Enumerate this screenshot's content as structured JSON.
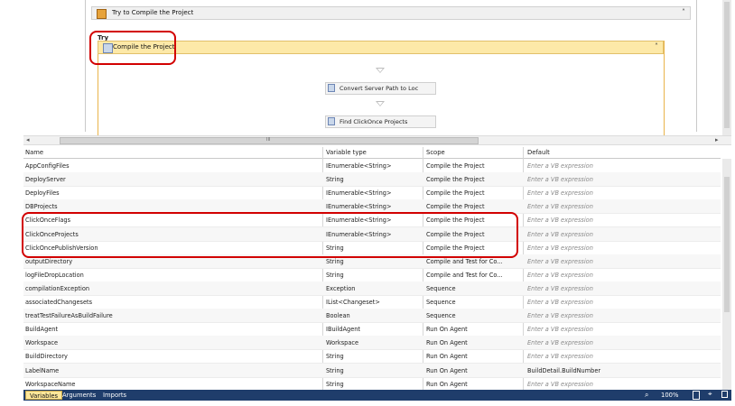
{
  "designer": {
    "outer_sequence": "Try to Compile the Project",
    "try_label": "Try",
    "inner_sequence": "Compile the Project",
    "activities": [
      "Convert Server Path to Loc",
      "Find ClickOnce Projects"
    ]
  },
  "hscroll_grip": "III",
  "grid": {
    "columns": [
      "Name",
      "Variable type",
      "Scope",
      "Default"
    ],
    "rows": [
      {
        "name": "AppConfigFiles",
        "type": "IEnumerable<String>",
        "scope": "Compile the Project",
        "default": "Enter a VB expression"
      },
      {
        "name": "DeployServer",
        "type": "String",
        "scope": "Compile the Project",
        "default": "Enter a VB expression"
      },
      {
        "name": "DeployFiles",
        "type": "IEnumerable<String>",
        "scope": "Compile the Project",
        "default": "Enter a VB expression"
      },
      {
        "name": "DBProjects",
        "type": "IEnumerable<String>",
        "scope": "Compile the Project",
        "default": "Enter a VB expression"
      },
      {
        "name": "ClickOnceFlags",
        "type": "IEnumerable<String>",
        "scope": "Compile the Project",
        "default": "Enter a VB expression"
      },
      {
        "name": "ClickOnceProjects",
        "type": "IEnumerable<String>",
        "scope": "Compile the Project",
        "default": "Enter a VB expression"
      },
      {
        "name": "ClickOncePublishVersion",
        "type": "String",
        "scope": "Compile the Project",
        "default": "Enter a VB expression"
      },
      {
        "name": "outputDirectory",
        "type": "String",
        "scope": "Compile and Test for Co...",
        "default": "Enter a VB expression"
      },
      {
        "name": "logFileDropLocation",
        "type": "String",
        "scope": "Compile and Test for Co...",
        "default": "Enter a VB expression"
      },
      {
        "name": "compilationException",
        "type": "Exception",
        "scope": "Sequence",
        "default": "Enter a VB expression"
      },
      {
        "name": "associatedChangesets",
        "type": "IList<Changeset>",
        "scope": "Sequence",
        "default": "Enter a VB expression"
      },
      {
        "name": "treatTestFailureAsBuildFailure",
        "type": "Boolean",
        "scope": "Sequence",
        "default": "Enter a VB expression"
      },
      {
        "name": "BuildAgent",
        "type": "IBuildAgent",
        "scope": "Run On Agent",
        "default": "Enter a VB expression"
      },
      {
        "name": "Workspace",
        "type": "Workspace",
        "scope": "Run On Agent",
        "default": "Enter a VB expression"
      },
      {
        "name": "BuildDirectory",
        "type": "String",
        "scope": "Run On Agent",
        "default": "Enter a VB expression"
      },
      {
        "name": "LabelName",
        "type": "String",
        "scope": "Run On Agent",
        "default": "BuildDetail.BuildNumber"
      },
      {
        "name": "WorkspaceName",
        "type": "String",
        "scope": "Run On Agent",
        "default": "Enter a VB expression"
      }
    ]
  },
  "status_bar": {
    "tabs": [
      "Variables",
      "Arguments",
      "Imports"
    ],
    "zoom": "100%"
  },
  "colors": {
    "status_bg": "#1f3d6b",
    "selected_sequence": "#fde9a8",
    "highlight": "#d20000"
  }
}
